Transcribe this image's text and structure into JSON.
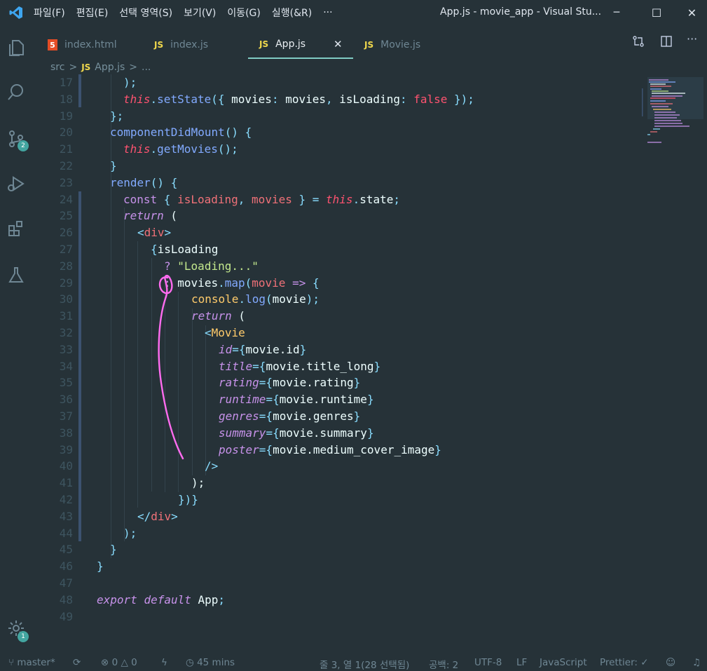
{
  "menu": [
    "파일(F)",
    "편집(E)",
    "선택 영역(S)",
    "보기(V)",
    "이동(G)",
    "실행(&R)",
    "···"
  ],
  "window_title": "App.js - movie_app - Visual Stu...",
  "window_buttons": {
    "minimize": "─",
    "maximize": "☐",
    "close": "✕"
  },
  "activity": {
    "scm_badge": "2",
    "settings_badge": "1"
  },
  "tabs": [
    {
      "icon": "5",
      "label": "index.html"
    },
    {
      "icon": "JS",
      "label": "index.js"
    },
    {
      "icon": "JS",
      "label": "App.js",
      "close": "✕"
    },
    {
      "icon": "JS",
      "label": "Movie.js"
    }
  ],
  "breadcrumb": {
    "folder": "src",
    "sep": ">",
    "icon": "JS",
    "file": "App.js",
    "sep2": ">",
    "more": "..."
  },
  "line_numbers": [
    "17",
    "18",
    "19",
    "20",
    "21",
    "22",
    "23",
    "24",
    "25",
    "26",
    "27",
    "28",
    "29",
    "30",
    "31",
    "32",
    "33",
    "34",
    "35",
    "36",
    "37",
    "38",
    "39",
    "40",
    "41",
    "42",
    "43",
    "44",
    "45",
    "46",
    "47",
    "48",
    "49"
  ],
  "code": {
    "l17": [
      ");"
    ],
    "l18": [
      "this",
      ".",
      "setState",
      "({ ",
      "movies",
      ": ",
      "movies",
      ", ",
      "isLoading",
      ": ",
      "false",
      " });"
    ],
    "l19": [
      "};"
    ],
    "l20": [
      "componentDidMount",
      "() {"
    ],
    "l21": [
      "this",
      ".",
      "getMovies",
      "();"
    ],
    "l22": [
      "}"
    ],
    "l23": [
      "render",
      "() {"
    ],
    "l24": [
      "const",
      " { ",
      "isLoading",
      ", ",
      "movies",
      " } ",
      "=",
      " ",
      "this",
      ".",
      "state",
      ";"
    ],
    "l25": [
      "return",
      " ("
    ],
    "l26": [
      "<",
      "div",
      ">"
    ],
    "l27": [
      "{",
      "isLoading"
    ],
    "l28": [
      "?",
      " ",
      "\"Loading...\""
    ],
    "l29": [
      ":",
      " ",
      "movies",
      ".",
      "map",
      "(",
      "movie",
      " => ",
      "{"
    ],
    "l30": [
      "console",
      ".",
      "log",
      "(",
      "movie",
      ");"
    ],
    "l31": [
      "return",
      " ("
    ],
    "l32": [
      "<",
      "Movie"
    ],
    "l33": [
      "id",
      "={",
      "movie.id",
      "}"
    ],
    "l34": [
      "title",
      "={",
      "movie.title_long",
      "}"
    ],
    "l35": [
      "rating",
      "={",
      "movie.rating",
      "}"
    ],
    "l36": [
      "runtime",
      "={",
      "movie.runtime",
      "}"
    ],
    "l37": [
      "genres",
      "={",
      "movie.genres",
      "}"
    ],
    "l38": [
      "summary",
      "={",
      "movie.summary",
      "}"
    ],
    "l39": [
      "poster",
      "={",
      "movie.medium_cover_image",
      "}"
    ],
    "l40": [
      "/>"
    ],
    "l41": [
      ");"
    ],
    "l42": [
      "})}"
    ],
    "l43": [
      "</",
      "div",
      ">"
    ],
    "l44": [
      ");"
    ],
    "l45": [
      "}"
    ],
    "l46": [
      "}"
    ],
    "l48": [
      "export",
      " ",
      "default",
      " ",
      "App",
      ";"
    ]
  },
  "status": {
    "branch": "master*",
    "errors": "0",
    "warnings": "0",
    "time": "45 mins",
    "position": "줄 3, 열 1(28 선택됨)",
    "spaces": "공백: 2",
    "encoding": "UTF-8",
    "eol": "LF",
    "language": "JavaScript",
    "formatter": "Prettier: ✓"
  },
  "colors": {
    "accent": "#80cbc4",
    "background": "#263238",
    "annotation": "#ff6cf0"
  }
}
